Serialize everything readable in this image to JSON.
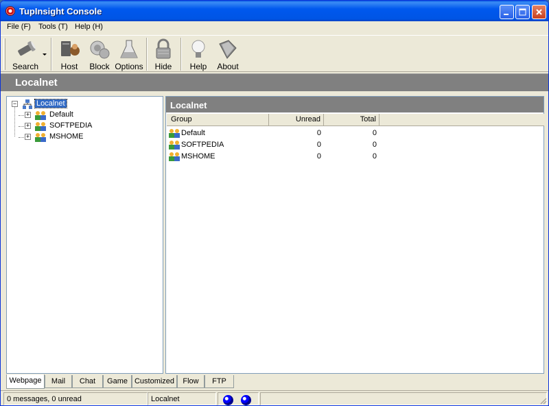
{
  "window": {
    "title": "TupInsight Console"
  },
  "menu": [
    {
      "label": "File (F)"
    },
    {
      "label": "Tools (T)"
    },
    {
      "label": "Help (H)"
    }
  ],
  "toolbar": {
    "search": "Search",
    "host": "Host",
    "block": "Block",
    "options": "Options",
    "hide": "Hide",
    "help": "Help",
    "about": "About"
  },
  "band": {
    "title": "Localnet"
  },
  "tree": {
    "root": "Localnet",
    "children": [
      "Default",
      "SOFTPEDIA",
      "MSHOME"
    ]
  },
  "right_pane": {
    "title": "Localnet",
    "columns": [
      "Group",
      "Unread",
      "Total"
    ],
    "rows": [
      {
        "group": "Default",
        "unread": "0",
        "total": "0"
      },
      {
        "group": "SOFTPEDIA",
        "unread": "0",
        "total": "0"
      },
      {
        "group": "MSHOME",
        "unread": "0",
        "total": "0"
      }
    ]
  },
  "tabs": [
    "Webpage",
    "Mail",
    "Chat",
    "Game",
    "Customized",
    "Flow",
    "FTP"
  ],
  "status": {
    "messages": "0 messages, 0 unread",
    "network": "Localnet"
  },
  "colors": {
    "titlebar": "#0055e5",
    "band": "#808080",
    "selection": "#316ac5",
    "status_led": "#0000ff"
  }
}
